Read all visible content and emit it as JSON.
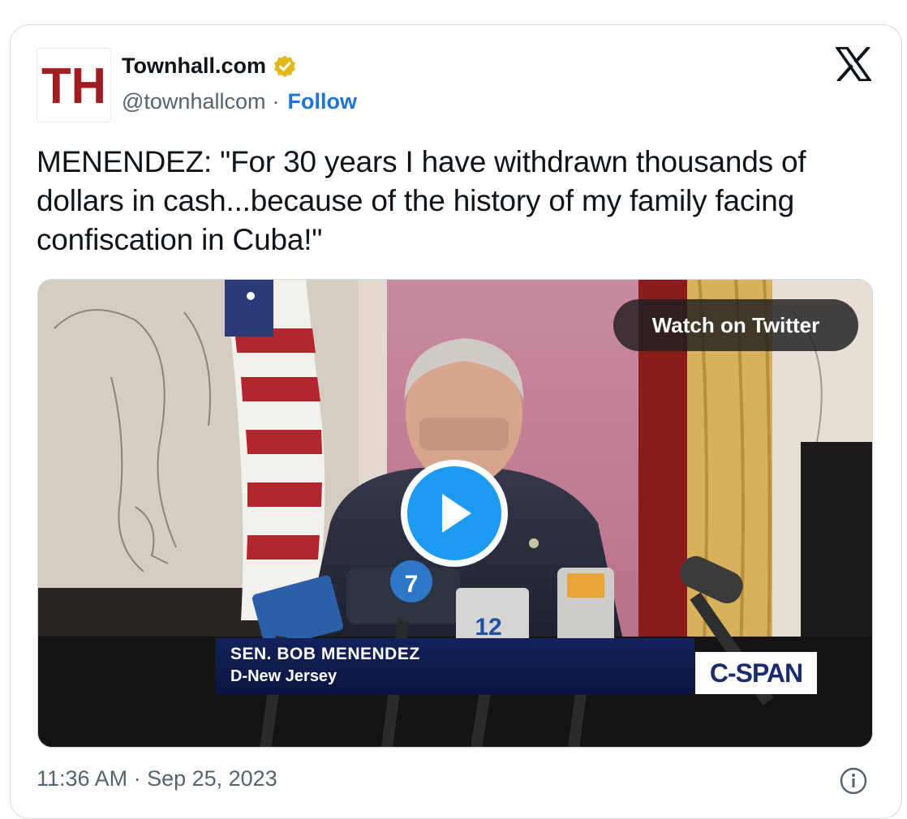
{
  "author": {
    "display_name": "Townhall.com",
    "handle": "@townhallcom",
    "separator": "·",
    "follow_label": "Follow",
    "avatar_text": "TH",
    "verified": true,
    "verified_badge_color": "#e2b719"
  },
  "platform": {
    "logo": "x-logo-icon"
  },
  "tweet": {
    "text": "MENENDEZ: \"For 30 years I have withdrawn thousands of dollars in cash...because of the history of my family facing confiscation in Cuba!\""
  },
  "media": {
    "watch_label": "Watch on Twitter",
    "chyron_name": "SEN. BOB MENENDEZ",
    "chyron_subtitle": "D-New Jersey",
    "network_logo": "C-SPAN",
    "mic_label_abc": "7",
    "mic_label_news12": "12"
  },
  "footer": {
    "timestamp": "11:36 AM · Sep 25, 2023",
    "info_icon": "info-icon"
  },
  "colors": {
    "follow": "#1d73d8",
    "play_button": "#1d9bf0",
    "text_secondary": "#536471",
    "brand_red": "#a11d21"
  }
}
